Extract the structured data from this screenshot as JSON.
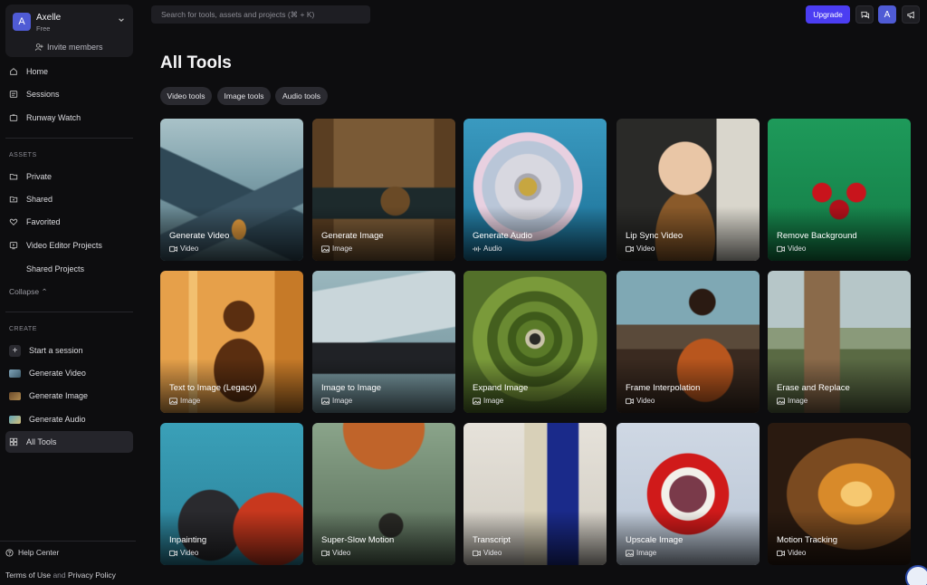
{
  "workspace": {
    "avatar_letter": "A",
    "name": "Axelle",
    "plan": "Free",
    "invite_label": "Invite members"
  },
  "nav": {
    "main": [
      {
        "label": "Home",
        "icon": "home-icon"
      },
      {
        "label": "Sessions",
        "icon": "sessions-icon"
      },
      {
        "label": "Runway Watch",
        "icon": "tv-icon"
      }
    ],
    "assets_label": "ASSETS",
    "assets": [
      {
        "label": "Private",
        "icon": "folder-icon"
      },
      {
        "label": "Shared",
        "icon": "shared-folder-icon"
      },
      {
        "label": "Favorited",
        "icon": "heart-icon"
      },
      {
        "label": "Video Editor Projects",
        "icon": "video-editor-icon"
      },
      {
        "label": "Shared Projects",
        "icon": ""
      }
    ],
    "collapse_label": "Collapse",
    "create_label": "CREATE",
    "create": [
      {
        "label": "Start a session",
        "icon": "plus-icon"
      },
      {
        "label": "Generate Video",
        "icon": "generate-video-thumb"
      },
      {
        "label": "Generate Image",
        "icon": "generate-image-thumb"
      },
      {
        "label": "Generate Audio",
        "icon": "generate-audio-thumb"
      },
      {
        "label": "All Tools",
        "icon": "grid-icon"
      }
    ],
    "help_label": "Help Center",
    "terms_label": "Terms of Use",
    "terms_and": "and",
    "privacy_label": "Privacy Policy"
  },
  "topbar": {
    "search_placeholder": "Search for tools, assets and projects (⌘ + K)",
    "upgrade_label": "Upgrade",
    "user_letter": "A"
  },
  "main": {
    "title": "All Tools",
    "chips": [
      "Video tools",
      "Image tools",
      "Audio tools"
    ],
    "tools": [
      {
        "title": "Generate Video",
        "type": "Video"
      },
      {
        "title": "Generate Image",
        "type": "Image"
      },
      {
        "title": "Generate Audio",
        "type": "Audio"
      },
      {
        "title": "Lip Sync Video",
        "type": "Video"
      },
      {
        "title": "Remove Background",
        "type": "Video"
      },
      {
        "title": "Text to Image (Legacy)",
        "type": "Image"
      },
      {
        "title": "Image to Image",
        "type": "Image"
      },
      {
        "title": "Expand Image",
        "type": "Image"
      },
      {
        "title": "Frame Interpolation",
        "type": "Video"
      },
      {
        "title": "Erase and Replace",
        "type": "Image"
      },
      {
        "title": "Inpainting",
        "type": "Video"
      },
      {
        "title": "Super-Slow Motion",
        "type": "Video"
      },
      {
        "title": "Transcript",
        "type": "Video"
      },
      {
        "title": "Upscale Image",
        "type": "Image"
      },
      {
        "title": "Motion Tracking",
        "type": "Video"
      }
    ]
  },
  "colors": {
    "accent": "#4b3df2",
    "avatar": "#4f5bd5",
    "background": "#0d0d0f"
  }
}
